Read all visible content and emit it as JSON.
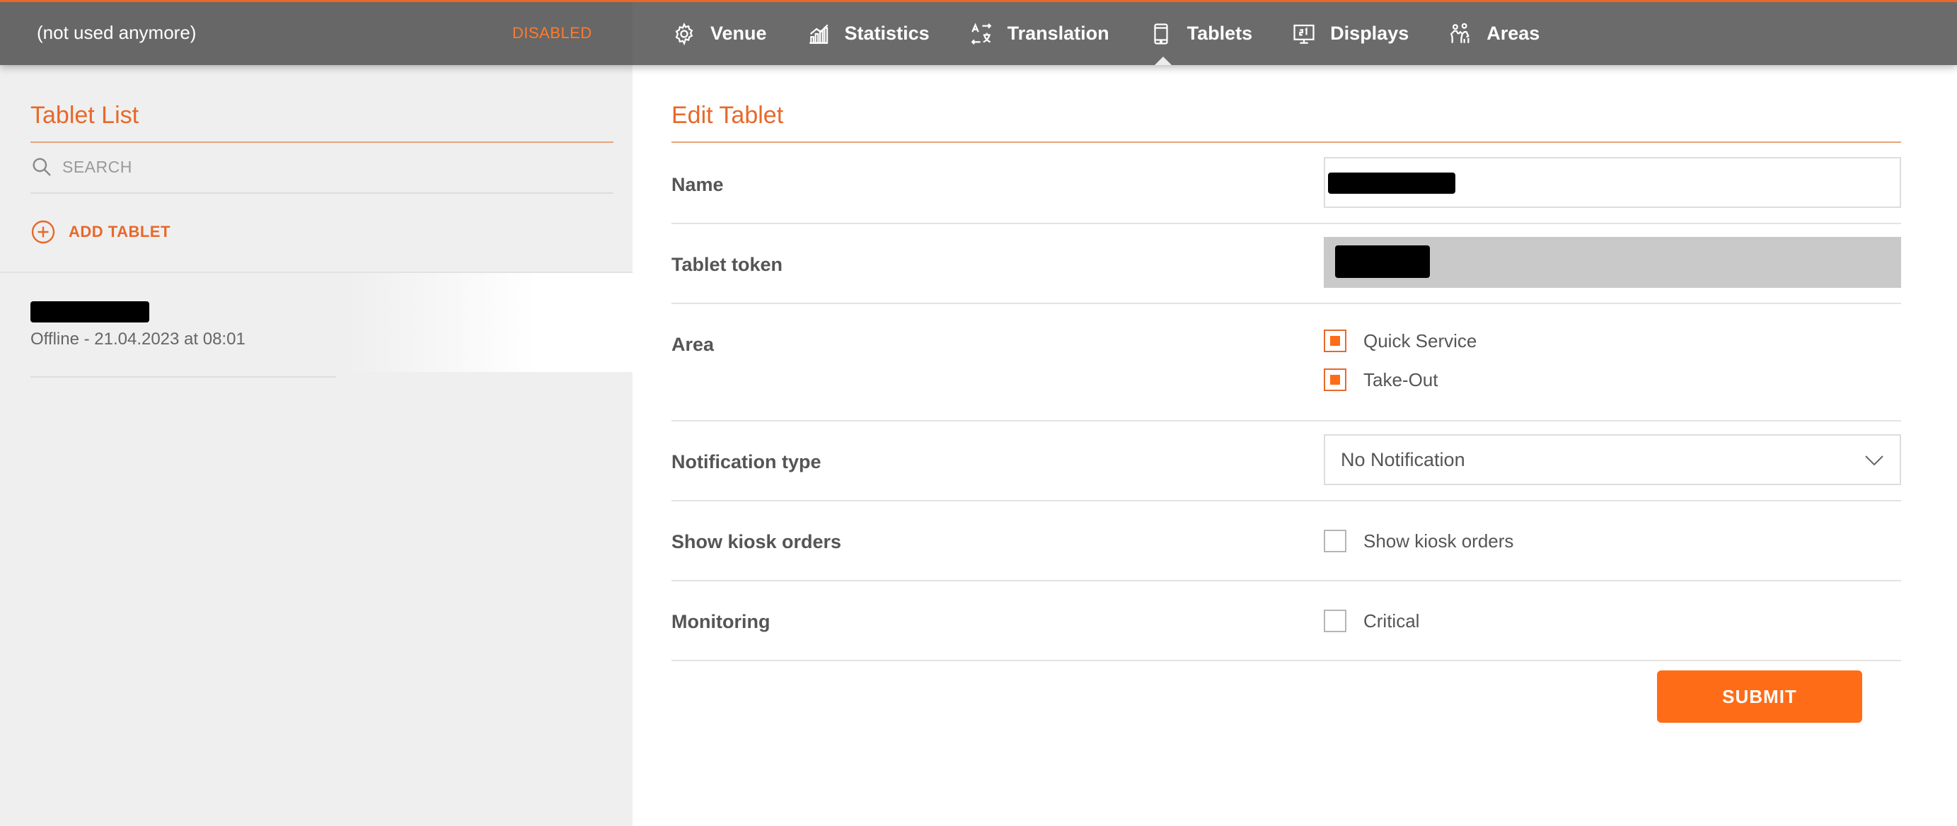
{
  "header": {
    "venue_name": "(not used anymore)",
    "venue_status": "DISABLED",
    "nav": [
      {
        "label": "Venue",
        "icon": "gear-icon"
      },
      {
        "label": "Statistics",
        "icon": "bar-chart-icon"
      },
      {
        "label": "Translation",
        "icon": "translate-icon"
      },
      {
        "label": "Tablets",
        "icon": "tablet-icon",
        "active": true
      },
      {
        "label": "Displays",
        "icon": "display-icon"
      },
      {
        "label": "Areas",
        "icon": "areas-icon"
      }
    ]
  },
  "sidebar": {
    "title": "Tablet List",
    "search_placeholder": "SEARCH",
    "add_label": "ADD TABLET",
    "tablets": [
      {
        "name": "",
        "status": "Offline - 21.04.2023 at 08:01"
      }
    ]
  },
  "form": {
    "title": "Edit Tablet",
    "name_label": "Name",
    "token_label": "Tablet token",
    "area_label": "Area",
    "areas": [
      {
        "label": "Quick Service",
        "checked": true
      },
      {
        "label": "Take-Out",
        "checked": true
      }
    ],
    "notification_label": "Notification type",
    "notification_value": "No Notification",
    "kiosk_label": "Show kiosk orders",
    "kiosk_checkbox_label": "Show kiosk orders",
    "monitoring_label": "Monitoring",
    "monitoring_checkbox_label": "Critical",
    "submit_label": "SUBMIT"
  },
  "colors": {
    "accent": "#e8682a",
    "button": "#ff6c17",
    "topbar": "#6b6b6b",
    "sidebar_bg": "#efefef"
  }
}
